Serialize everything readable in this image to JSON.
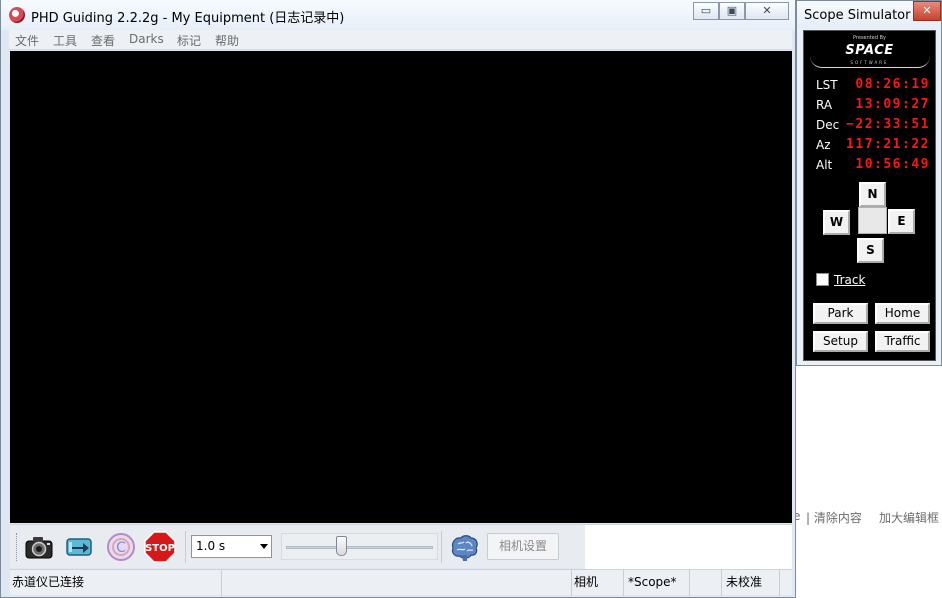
{
  "background": {
    "text_left": "e",
    "text_clear": "| 清除内容",
    "text_enlarge": "加大编辑框"
  },
  "phd": {
    "title": "PHD Guiding 2.2.2g - My Equipment (日志记录中)",
    "window_controls": {
      "minimize": "▭",
      "restore": "▣",
      "close": "✕"
    },
    "menu": [
      "文件",
      "工具",
      "查看",
      "Darks",
      "标记",
      "帮助"
    ],
    "toolbar": {
      "exposure": "1.0 s",
      "camera_settings_label": "相机设置",
      "stop_label": "STOP"
    },
    "status": {
      "message": "赤道仪已连接",
      "camera": "相机",
      "scope": "*Scope*",
      "calibration": "未校准"
    }
  },
  "scope_sim": {
    "title": "Scope Simulator",
    "close": "✕",
    "logo": {
      "presented": "Presented By",
      "name": "SPACE",
      "sub": "SOFTWARE"
    },
    "coords": [
      {
        "label": "LST",
        "value": "08:26:19"
      },
      {
        "label": "RA",
        "value": "13:09:27"
      },
      {
        "label": "Dec",
        "value": "−22:33:51"
      },
      {
        "label": "Az",
        "value": "117:21:22"
      },
      {
        "label": "Alt",
        "value": "10:56:49"
      }
    ],
    "directions": {
      "north": "N",
      "south": "S",
      "east": "E",
      "west": "W"
    },
    "track_label": "Track",
    "buttons": {
      "park": "Park",
      "home": "Home",
      "setup": "Setup",
      "traffic": "Traffic"
    }
  }
}
